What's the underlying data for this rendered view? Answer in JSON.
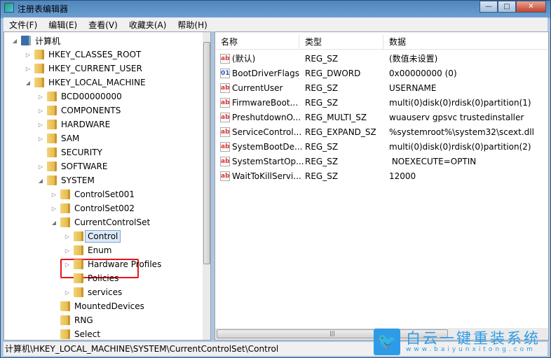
{
  "window": {
    "title": "注册表编辑器",
    "minimize": "—",
    "maximize": "□",
    "close": "✕"
  },
  "menu": [
    "文件(F)",
    "编辑(E)",
    "查看(V)",
    "收藏夹(A)",
    "帮助(H)"
  ],
  "tree": [
    {
      "label": "计算机",
      "level": 0,
      "toggle": "◢",
      "icon": "computer"
    },
    {
      "label": "HKEY_CLASSES_ROOT",
      "level": 1,
      "toggle": "▷"
    },
    {
      "label": "HKEY_CURRENT_USER",
      "level": 1,
      "toggle": "▷"
    },
    {
      "label": "HKEY_LOCAL_MACHINE",
      "level": 1,
      "toggle": "◢"
    },
    {
      "label": "BCD00000000",
      "level": 2,
      "toggle": "▷"
    },
    {
      "label": "COMPONENTS",
      "level": 2,
      "toggle": "▷"
    },
    {
      "label": "HARDWARE",
      "level": 2,
      "toggle": "▷"
    },
    {
      "label": "SAM",
      "level": 2,
      "toggle": "▷"
    },
    {
      "label": "SECURITY",
      "level": 2,
      "toggle": ""
    },
    {
      "label": "SOFTWARE",
      "level": 2,
      "toggle": "▷"
    },
    {
      "label": "SYSTEM",
      "level": 2,
      "toggle": "◢"
    },
    {
      "label": "ControlSet001",
      "level": 3,
      "toggle": "▷"
    },
    {
      "label": "ControlSet002",
      "level": 3,
      "toggle": "▷"
    },
    {
      "label": "CurrentControlSet",
      "level": 3,
      "toggle": "◢"
    },
    {
      "label": "Control",
      "level": 4,
      "toggle": "▷",
      "selected": true
    },
    {
      "label": "Enum",
      "level": 4,
      "toggle": "▷"
    },
    {
      "label": "Hardware Profiles",
      "level": 4,
      "toggle": "▷"
    },
    {
      "label": "Policies",
      "level": 4,
      "toggle": ""
    },
    {
      "label": "services",
      "level": 4,
      "toggle": "▷"
    },
    {
      "label": "MountedDevices",
      "level": 3,
      "toggle": ""
    },
    {
      "label": "RNG",
      "level": 3,
      "toggle": ""
    },
    {
      "label": "Select",
      "level": 3,
      "toggle": ""
    }
  ],
  "columns": [
    "名称",
    "类型",
    "数据"
  ],
  "values": [
    {
      "name": "(默认)",
      "type": "REG_SZ",
      "data": "(数值未设置)",
      "icon": "ab"
    },
    {
      "name": "BootDriverFlags",
      "type": "REG_DWORD",
      "data": "0x00000000 (0)",
      "icon": "binary"
    },
    {
      "name": "CurrentUser",
      "type": "REG_SZ",
      "data": "USERNAME",
      "icon": "ab"
    },
    {
      "name": "FirmwareBoot...",
      "type": "REG_SZ",
      "data": "multi(0)disk(0)rdisk(0)partition(1)",
      "icon": "ab"
    },
    {
      "name": "PreshutdownO...",
      "type": "REG_MULTI_SZ",
      "data": "wuauserv gpsvc trustedinstaller",
      "icon": "ab"
    },
    {
      "name": "ServiceControl...",
      "type": "REG_EXPAND_SZ",
      "data": "%systemroot%\\system32\\scext.dll",
      "icon": "ab"
    },
    {
      "name": "SystemBootDe...",
      "type": "REG_SZ",
      "data": "multi(0)disk(0)rdisk(0)partition(2)",
      "icon": "ab"
    },
    {
      "name": "SystemStartOp...",
      "type": "REG_SZ",
      "data": " NOEXECUTE=OPTIN",
      "icon": "ab"
    },
    {
      "name": "WaitToKillServi...",
      "type": "REG_SZ",
      "data": "12000",
      "icon": "ab"
    }
  ],
  "status": "计算机\\HKEY_LOCAL_MACHINE\\SYSTEM\\CurrentControlSet\\Control",
  "watermark": {
    "title": "白云一键重装系统",
    "url": "www.baiyunxitong.com"
  },
  "colors": {
    "highlight": "#e8151b",
    "watermark": "#2d9be8"
  }
}
